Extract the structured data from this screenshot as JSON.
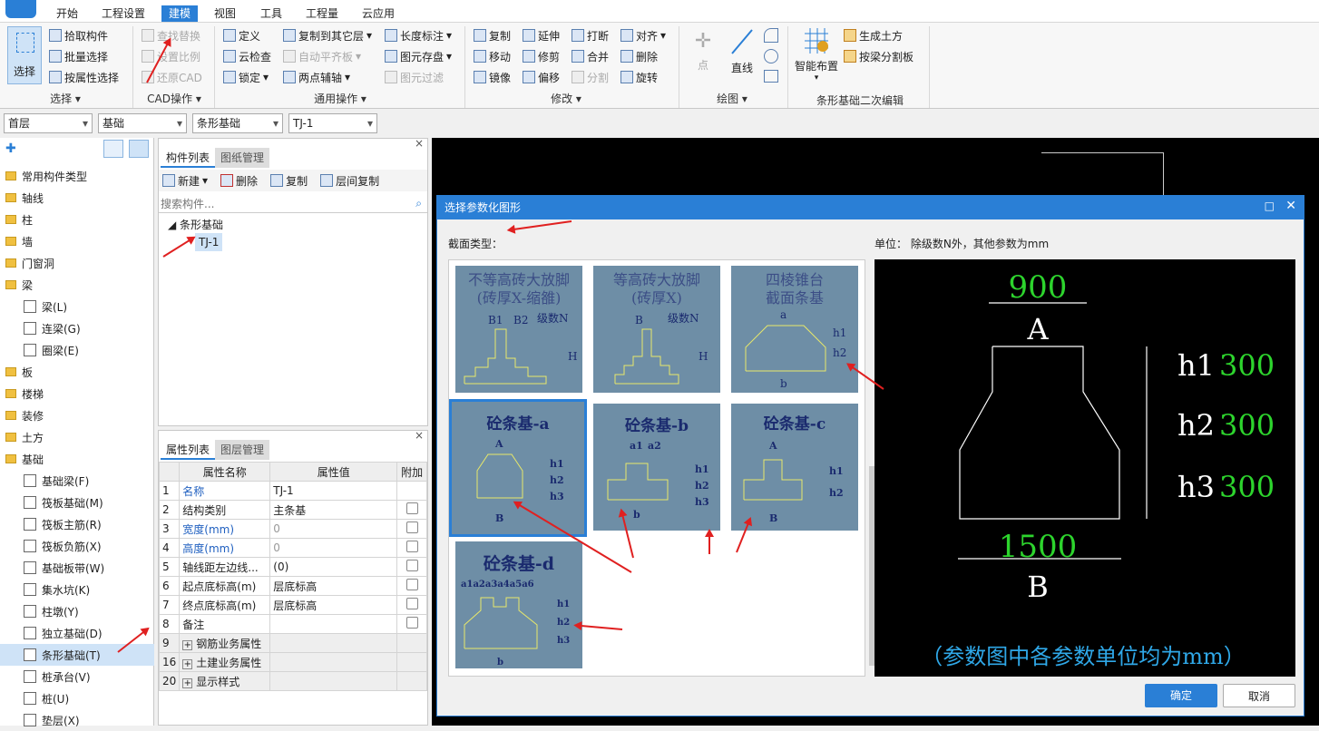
{
  "menubar": {
    "items": [
      "开始",
      "工程设置",
      "建模",
      "视图",
      "工具",
      "工程量",
      "云应用"
    ]
  },
  "ribbon": {
    "select": {
      "big": "选择",
      "items": [
        "拾取构件",
        "批量选择",
        "按属性选择"
      ],
      "group": "选择"
    },
    "cad": {
      "items": [
        "查找替换",
        "设置比例",
        "还原CAD"
      ],
      "group": "CAD操作"
    },
    "general": {
      "col1": [
        "定义",
        "云检查",
        "锁定"
      ],
      "col2": [
        "复制到其它层",
        "自动平齐板",
        "两点辅轴"
      ],
      "col3": [
        "长度标注",
        "图元存盘",
        "图元过滤"
      ],
      "group": "通用操作"
    },
    "modify": {
      "col1": [
        "复制",
        "移动",
        "镜像"
      ],
      "col2": [
        "延伸",
        "修剪",
        "偏移"
      ],
      "col3": [
        "打断",
        "合并",
        "分割"
      ],
      "col4": [
        "对齐",
        "删除",
        "旋转"
      ],
      "group": "修改"
    },
    "draw": {
      "point": "点",
      "line": "直线",
      "group": "绘图"
    },
    "strip": {
      "big": "智能布置",
      "items": [
        "生成土方",
        "按梁分割板"
      ],
      "group": "条形基础二次编辑"
    }
  },
  "combos": [
    "首层",
    "基础",
    "条形基础",
    "TJ-1"
  ],
  "tree": {
    "items": [
      {
        "label": "常用构件类型",
        "type": "folder"
      },
      {
        "label": "轴线",
        "type": "folder"
      },
      {
        "label": "柱",
        "type": "folder"
      },
      {
        "label": "墙",
        "type": "folder"
      },
      {
        "label": "门窗洞",
        "type": "folder"
      },
      {
        "label": "梁",
        "type": "folder"
      },
      {
        "label": "梁(L)",
        "type": "sub"
      },
      {
        "label": "连梁(G)",
        "type": "sub"
      },
      {
        "label": "圈梁(E)",
        "type": "sub"
      },
      {
        "label": "板",
        "type": "folder"
      },
      {
        "label": "楼梯",
        "type": "folder"
      },
      {
        "label": "装修",
        "type": "folder"
      },
      {
        "label": "土方",
        "type": "folder"
      },
      {
        "label": "基础",
        "type": "folder"
      },
      {
        "label": "基础梁(F)",
        "type": "sub"
      },
      {
        "label": "筏板基础(M)",
        "type": "sub"
      },
      {
        "label": "筏板主筋(R)",
        "type": "sub"
      },
      {
        "label": "筏板负筋(X)",
        "type": "sub"
      },
      {
        "label": "基础板带(W)",
        "type": "sub"
      },
      {
        "label": "集水坑(K)",
        "type": "sub"
      },
      {
        "label": "柱墩(Y)",
        "type": "sub"
      },
      {
        "label": "独立基础(D)",
        "type": "sub"
      },
      {
        "label": "条形基础(T)",
        "type": "sub",
        "selected": true
      },
      {
        "label": "桩承台(V)",
        "type": "sub"
      },
      {
        "label": "桩(U)",
        "type": "sub"
      },
      {
        "label": "垫层(X)",
        "type": "sub"
      }
    ]
  },
  "component_list": {
    "tabs": [
      "构件列表",
      "图纸管理"
    ],
    "toolbar": [
      "新建",
      "删除",
      "复制",
      "层间复制"
    ],
    "search_placeholder": "搜索构件...",
    "parent": "条形基础",
    "child": "TJ-1"
  },
  "properties": {
    "tabs": [
      "属性列表",
      "图层管理"
    ],
    "headers": [
      "属性名称",
      "属性值",
      "附加"
    ],
    "rows": [
      {
        "no": "1",
        "name": "名称",
        "value": "TJ-1",
        "blue": true,
        "check": false
      },
      {
        "no": "2",
        "name": "结构类别",
        "value": "主条基",
        "blue": false,
        "check": true
      },
      {
        "no": "3",
        "name": "宽度(mm)",
        "value": "0",
        "blue": true,
        "check": true,
        "grey": true
      },
      {
        "no": "4",
        "name": "高度(mm)",
        "value": "0",
        "blue": true,
        "check": true,
        "grey": true
      },
      {
        "no": "5",
        "name": "轴线距左边线...",
        "value": "(0)",
        "blue": false,
        "check": true
      },
      {
        "no": "6",
        "name": "起点底标高(m)",
        "value": "层底标高",
        "blue": false,
        "check": true
      },
      {
        "no": "7",
        "name": "终点底标高(m)",
        "value": "层底标高",
        "blue": false,
        "check": true
      },
      {
        "no": "8",
        "name": "备注",
        "value": "",
        "blue": false,
        "check": true
      },
      {
        "no": "9",
        "name": "钢筋业务属性",
        "value": "",
        "expand": true
      },
      {
        "no": "16",
        "name": "土建业务属性",
        "value": "",
        "expand": true
      },
      {
        "no": "20",
        "name": "显示样式",
        "value": "",
        "expand": true
      }
    ]
  },
  "dialog": {
    "title": "选择参数化图形",
    "section_label": "截面类型：",
    "unit_label": "单位：  除级数N外，其他参数为mm",
    "thumbs": [
      {
        "title": "不等高砖大放脚\n(砖厚X-缩雒)",
        "labels": [
          "B1",
          "B2",
          "级数N",
          "H"
        ]
      },
      {
        "title": "等高砖大放脚\n(砖厚X)",
        "labels": [
          "B",
          "级数N",
          "H"
        ]
      },
      {
        "title": "四棱锥台\n截面条基",
        "labels": [
          "a",
          "h1",
          "h2",
          "b"
        ]
      },
      {
        "title": "砼条基-a",
        "labels": [
          "A",
          "h1",
          "h2",
          "h3",
          "B"
        ]
      },
      {
        "title": "砼条基-b",
        "labels": [
          "a1",
          "a2",
          "h1",
          "h2",
          "h3",
          "b"
        ]
      },
      {
        "title": "砼条基-c",
        "labels": [
          "A",
          "h1",
          "h2",
          "B"
        ]
      },
      {
        "title": "砼条基-d",
        "labels": [
          "a1a2a3a4a5a6",
          "h1",
          "h2",
          "h3",
          "b"
        ]
      }
    ],
    "preview": {
      "top_value": "900",
      "top_label": "A",
      "h1_label": "h1",
      "h1_value": "300",
      "h2_label": "h2",
      "h2_value": "300",
      "h3_label": "h3",
      "h3_value": "300",
      "bottom_value": "1500",
      "bottom_label": "B",
      "note": "（参数图中各参数单位均为mm）"
    },
    "ok": "确定",
    "cancel": "取消"
  }
}
